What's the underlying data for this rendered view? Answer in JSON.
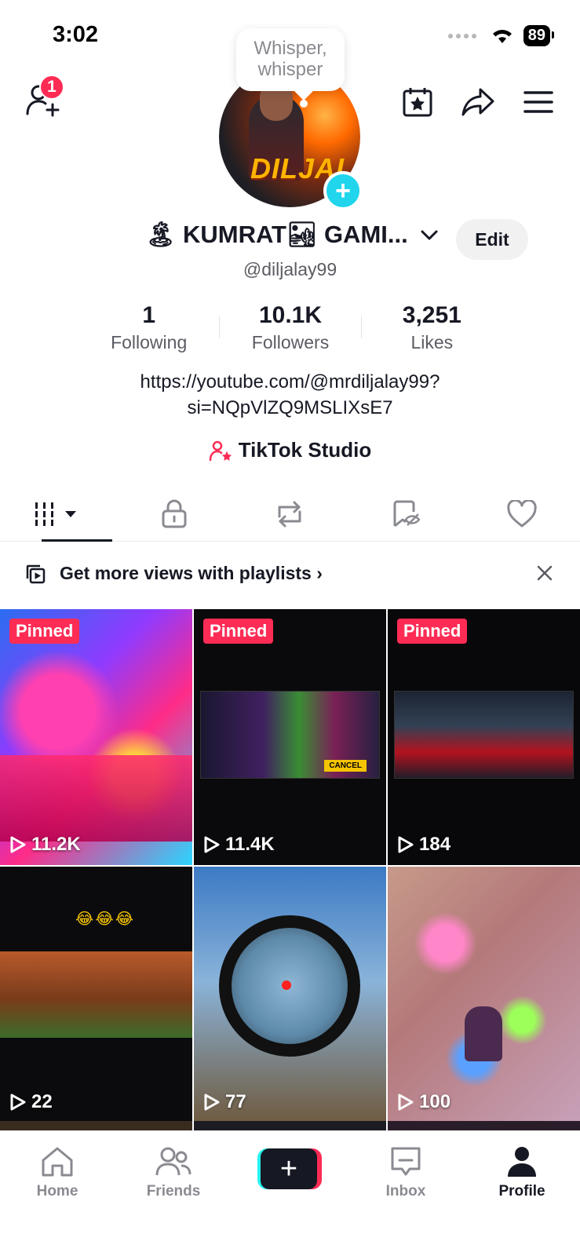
{
  "status_bar": {
    "time": "3:02",
    "battery": "89"
  },
  "header": {
    "notification_count": "1",
    "whisper_text": "Whisper, whisper"
  },
  "profile": {
    "nickname": "🏝 KUMRAT🏜 GAMI...",
    "username": "@diljalay99",
    "edit_label": "Edit",
    "avatar_text": "DILJAL",
    "stats": [
      {
        "value": "1",
        "label": "Following"
      },
      {
        "value": "10.1K",
        "label": "Followers"
      },
      {
        "value": "3,251",
        "label": "Likes"
      }
    ],
    "bio_line1": "https://youtube.com/@mrdiljalay99?",
    "bio_line2": "si=NQpVlZQ9MSLIXsE7",
    "studio_label": "TikTok Studio"
  },
  "tabs": [
    {
      "name": "videos",
      "icon": "grid-icon"
    },
    {
      "name": "private",
      "icon": "lock-icon"
    },
    {
      "name": "reposts",
      "icon": "repost-icon"
    },
    {
      "name": "favorites",
      "icon": "bookmark-icon"
    },
    {
      "name": "liked",
      "icon": "heart-icon"
    }
  ],
  "playlist_banner": {
    "text": "Get more views with playlists"
  },
  "videos": [
    {
      "pinned": "Pinned",
      "views": "11.2K"
    },
    {
      "pinned": "Pinned",
      "views": "11.4K",
      "overlay": "CANCEL"
    },
    {
      "pinned": "Pinned",
      "views": "184"
    },
    {
      "views": "22"
    },
    {
      "views": "77"
    },
    {
      "views": "100"
    }
  ],
  "bottom_nav": [
    {
      "label": "Home"
    },
    {
      "label": "Friends"
    },
    {
      "label": "Inbox"
    },
    {
      "label": "Profile"
    }
  ],
  "colors": {
    "accent": "#fe2c55",
    "cyan": "#20d5ec",
    "text": "#161823",
    "muted": "#5b5c63"
  }
}
